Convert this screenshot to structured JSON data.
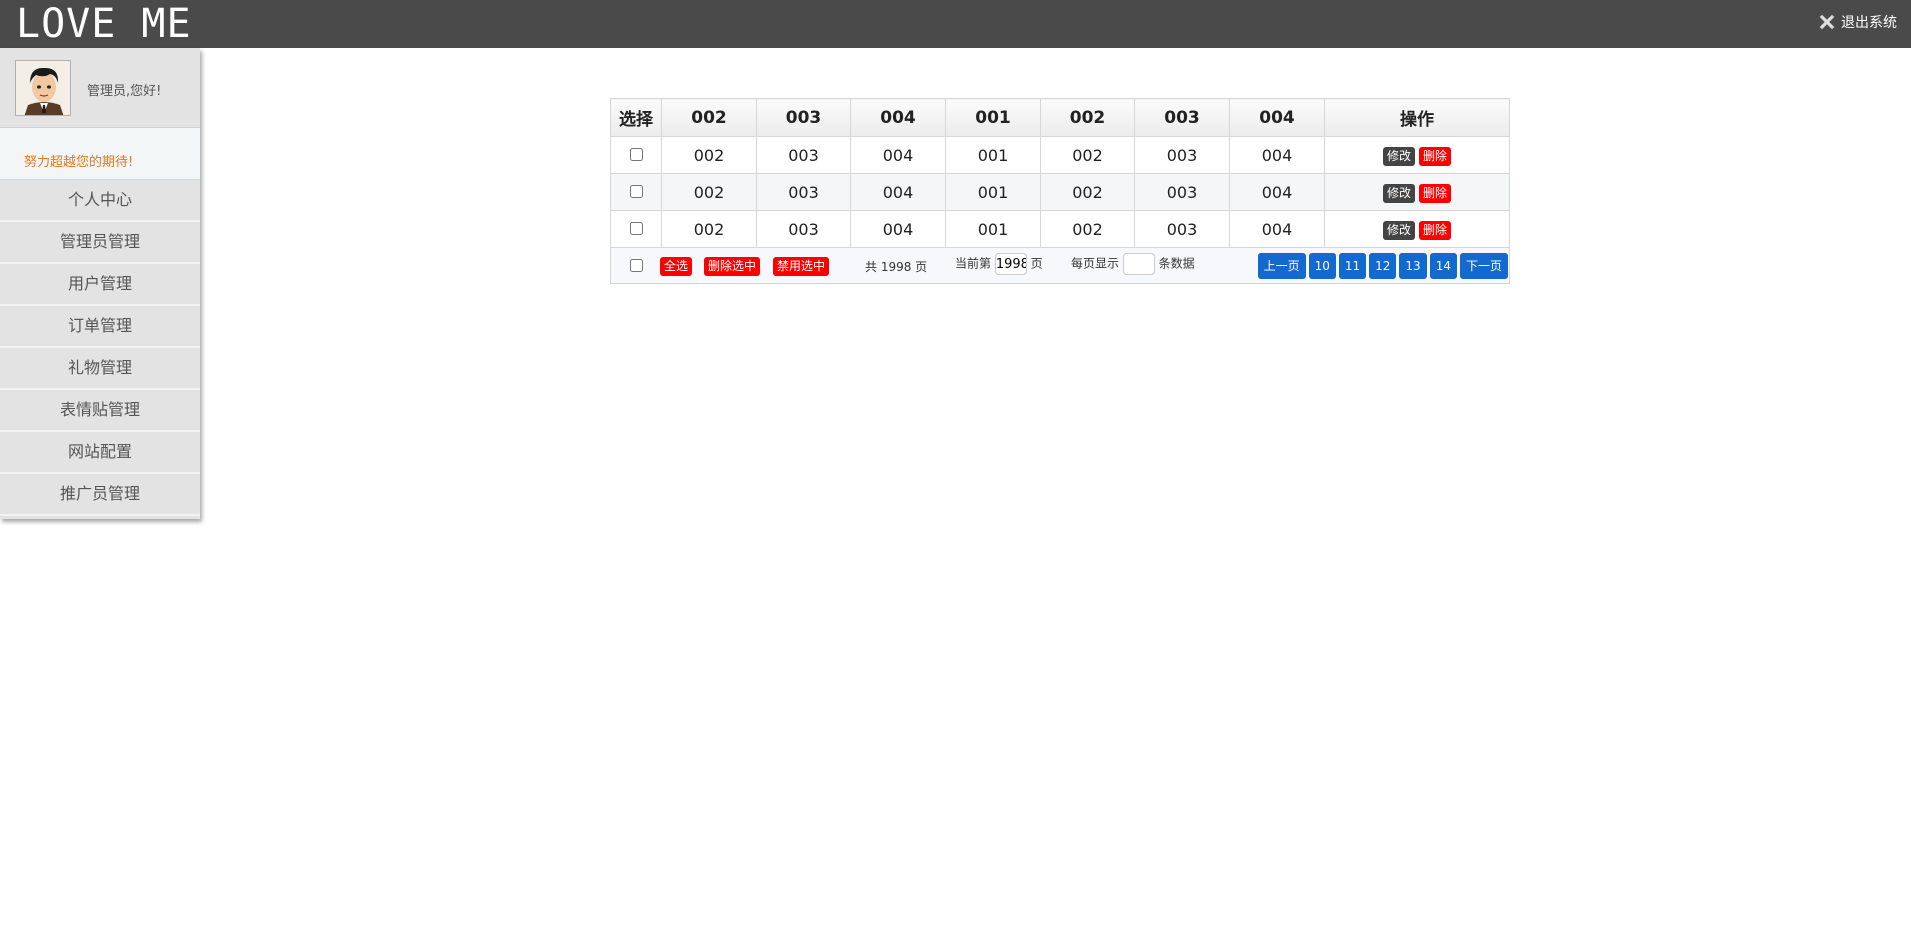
{
  "app": {
    "logo": "LOVE ME",
    "logout_label": "退出系统"
  },
  "sidebar": {
    "greeting": "管理员,您好!",
    "motto": "努力超越您的期待!",
    "items": [
      {
        "label": "个人中心"
      },
      {
        "label": "管理员管理"
      },
      {
        "label": "用户管理"
      },
      {
        "label": "订单管理"
      },
      {
        "label": "礼物管理"
      },
      {
        "label": "表情贴管理"
      },
      {
        "label": "网站配置"
      },
      {
        "label": "推广员管理"
      }
    ]
  },
  "table": {
    "headers": [
      "选择",
      "002",
      "003",
      "004",
      "001",
      "002",
      "003",
      "004",
      "操作"
    ],
    "rows": [
      [
        "002",
        "003",
        "004",
        "001",
        "002",
        "003",
        "004"
      ],
      [
        "002",
        "003",
        "004",
        "001",
        "002",
        "003",
        "004"
      ],
      [
        "002",
        "003",
        "004",
        "001",
        "002",
        "003",
        "004"
      ]
    ],
    "edit_label": "修改",
    "delete_label": "删除"
  },
  "footer": {
    "select_all": "全选",
    "delete_selected": "删除选中",
    "disable_selected": "禁用选中",
    "total_pages": "共 1998 页",
    "current_prefix": "当前第",
    "current_page": "1998",
    "current_suffix": "页",
    "per_page_prefix": "每页显示",
    "per_page_suffix": "条数据",
    "prev": "上一页",
    "pages": [
      "10",
      "11",
      "12",
      "13",
      "14"
    ],
    "next": "下一页"
  },
  "colors": {
    "topbar": "#4a4a4a",
    "danger": "#ff0000",
    "primary": "#1469cf",
    "motto": "#e3781f"
  }
}
